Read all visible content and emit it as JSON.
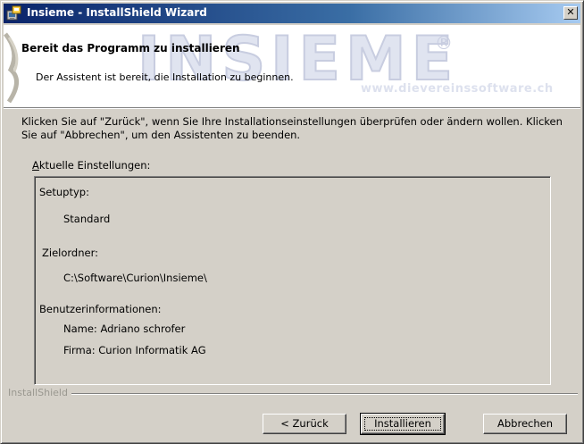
{
  "window": {
    "title": "Insieme - InstallShield Wizard",
    "close_glyph": "✕"
  },
  "banner": {
    "title": "Bereit das Programm zu installieren",
    "subtitle": "Der Assistent ist bereit, die Installation zu beginnen.",
    "logo_text": "INSIEME",
    "logo_reg": "®",
    "url": "www.dievereinssoftware.ch"
  },
  "body": {
    "instructions": "Klicken Sie auf \"Zurück\", wenn Sie Ihre Installationseinstellungen überprüfen oder ändern wollen. Klicken Sie auf \"Abbrechen\", um den Assistenten zu beenden.",
    "settings_label_accel": "A",
    "settings_label_rest": "ktuelle Einstellungen:"
  },
  "settings": {
    "setup_type_label": "Setuptyp:",
    "setup_type_value": "Standard",
    "target_folder_label": "Zielordner:",
    "target_folder_value": "C:\\Software\\Curion\\Insieme\\",
    "user_info_label": "Benutzerinformationen:",
    "user_name": "Name: Adriano schrofer",
    "user_company": "Firma: Curion Informatik AG"
  },
  "footer": {
    "brand": "InstallShield"
  },
  "buttons": {
    "back": "< Zurück",
    "install": "Installieren",
    "cancel": "Abbrechen"
  },
  "colors": {
    "titlebar_start": "#0a246a",
    "titlebar_end": "#a6caf0",
    "face": "#d4d0c8"
  }
}
